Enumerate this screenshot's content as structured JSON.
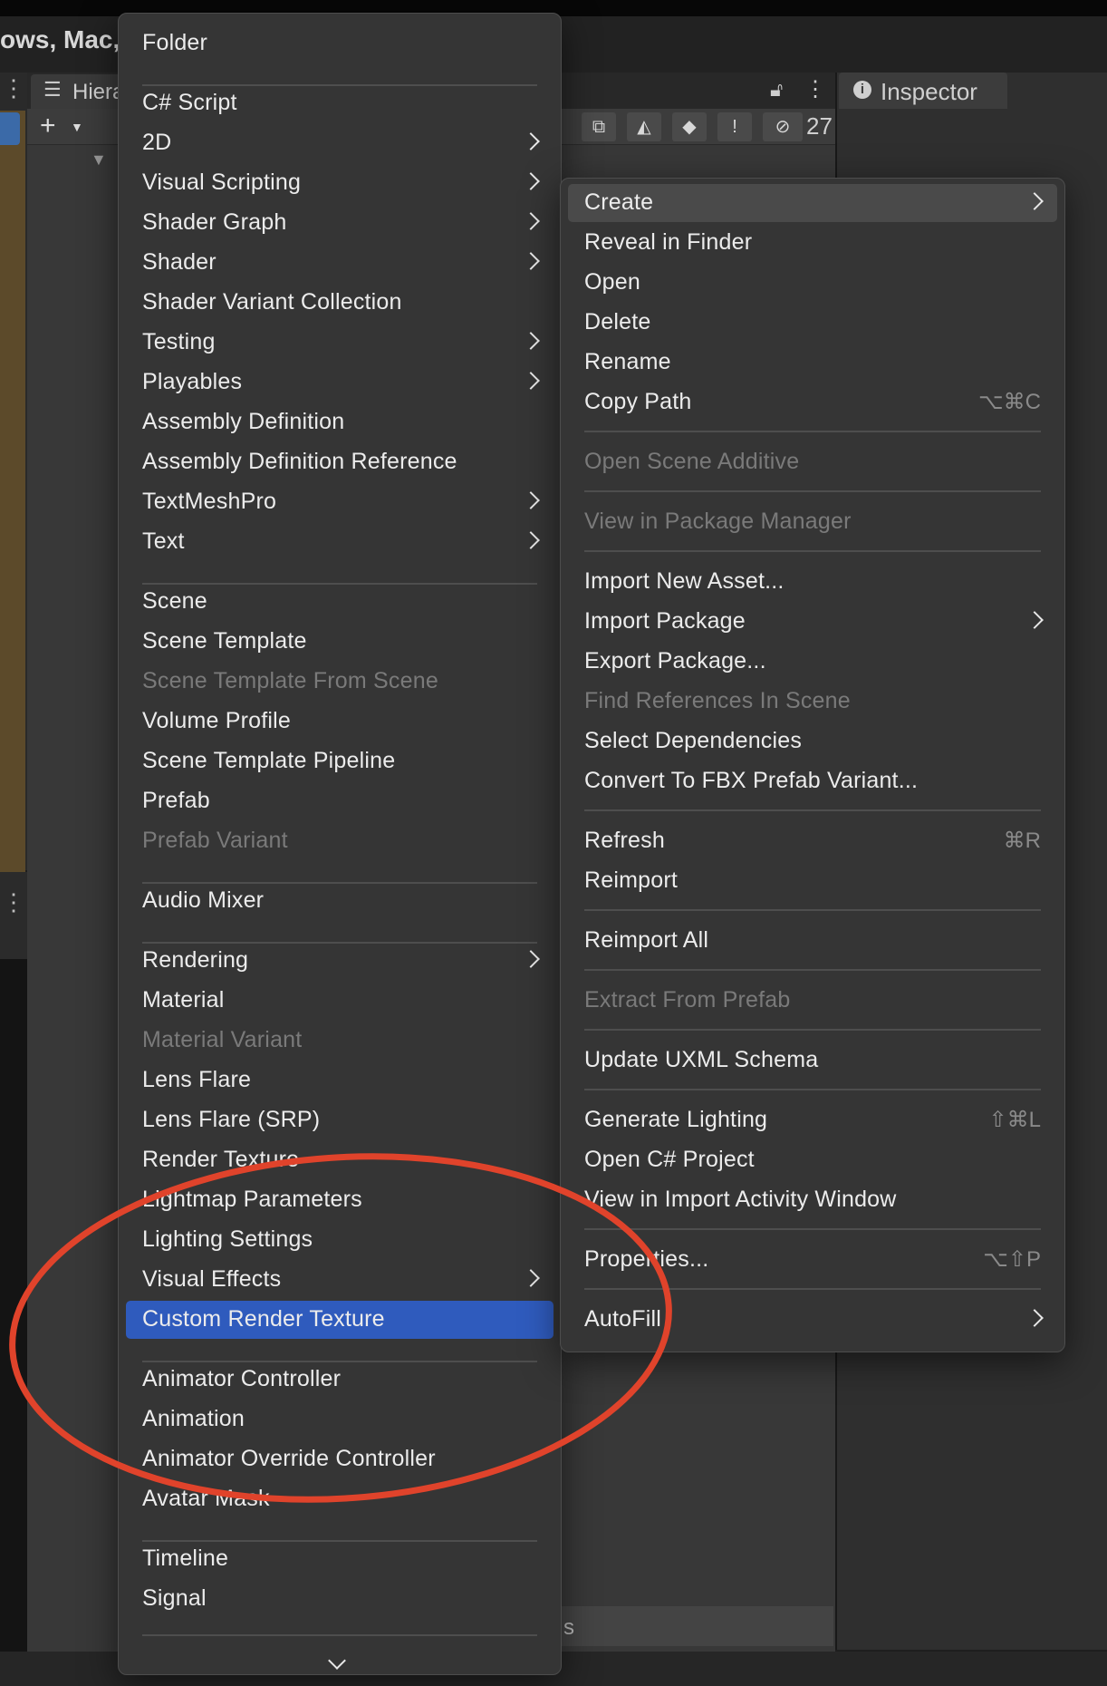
{
  "window": {
    "title_fragment": "ows, Mac,"
  },
  "hierarchy": {
    "tab_label": "Hiera",
    "visibility_count": "27"
  },
  "inspector": {
    "tab_label": "Inspector"
  },
  "project": {
    "bottom_fragment": "s"
  },
  "left_menu": {
    "items": [
      {
        "label": "Folder",
        "submenu": false,
        "disabled": false
      },
      {
        "label": "C# Script",
        "submenu": false,
        "disabled": false
      },
      {
        "label": "2D",
        "submenu": true,
        "disabled": false
      },
      {
        "label": "Visual Scripting",
        "submenu": true,
        "disabled": false
      },
      {
        "label": "Shader Graph",
        "submenu": true,
        "disabled": false
      },
      {
        "label": "Shader",
        "submenu": true,
        "disabled": false
      },
      {
        "label": "Shader Variant Collection",
        "submenu": false,
        "disabled": false
      },
      {
        "label": "Testing",
        "submenu": true,
        "disabled": false
      },
      {
        "label": "Playables",
        "submenu": true,
        "disabled": false
      },
      {
        "label": "Assembly Definition",
        "submenu": false,
        "disabled": false
      },
      {
        "label": "Assembly Definition Reference",
        "submenu": false,
        "disabled": false
      },
      {
        "label": "TextMeshPro",
        "submenu": true,
        "disabled": false
      },
      {
        "label": "Text",
        "submenu": true,
        "disabled": false
      },
      {
        "label": "Scene",
        "submenu": false,
        "disabled": false
      },
      {
        "label": "Scene Template",
        "submenu": false,
        "disabled": false
      },
      {
        "label": "Scene Template From Scene",
        "submenu": false,
        "disabled": true
      },
      {
        "label": "Volume Profile",
        "submenu": false,
        "disabled": false
      },
      {
        "label": "Scene Template Pipeline",
        "submenu": false,
        "disabled": false
      },
      {
        "label": "Prefab",
        "submenu": false,
        "disabled": false
      },
      {
        "label": "Prefab Variant",
        "submenu": false,
        "disabled": true
      },
      {
        "label": "Audio Mixer",
        "submenu": false,
        "disabled": false
      },
      {
        "label": "Rendering",
        "submenu": true,
        "disabled": false
      },
      {
        "label": "Material",
        "submenu": false,
        "disabled": false
      },
      {
        "label": "Material Variant",
        "submenu": false,
        "disabled": true
      },
      {
        "label": "Lens Flare",
        "submenu": false,
        "disabled": false
      },
      {
        "label": "Lens Flare (SRP)",
        "submenu": false,
        "disabled": false
      },
      {
        "label": "Render Texture",
        "submenu": false,
        "disabled": false
      },
      {
        "label": "Lightmap Parameters",
        "submenu": false,
        "disabled": false
      },
      {
        "label": "Lighting Settings",
        "submenu": false,
        "disabled": false
      },
      {
        "label": "Visual Effects",
        "submenu": true,
        "disabled": false
      },
      {
        "label": "Custom Render Texture",
        "submenu": false,
        "disabled": false,
        "selected": true
      },
      {
        "label": "Animator Controller",
        "submenu": false,
        "disabled": false
      },
      {
        "label": "Animation",
        "submenu": false,
        "disabled": false
      },
      {
        "label": "Animator Override Controller",
        "submenu": false,
        "disabled": false
      },
      {
        "label": "Avatar Mask",
        "submenu": false,
        "disabled": false
      },
      {
        "label": "Timeline",
        "submenu": false,
        "disabled": false
      },
      {
        "label": "Signal",
        "submenu": false,
        "disabled": false
      }
    ]
  },
  "right_menu": {
    "items": [
      {
        "label": "Create",
        "submenu": true,
        "disabled": false,
        "highlighted": true
      },
      {
        "label": "Reveal in Finder",
        "disabled": false
      },
      {
        "label": "Open",
        "disabled": false
      },
      {
        "label": "Delete",
        "disabled": false
      },
      {
        "label": "Rename",
        "disabled": false
      },
      {
        "label": "Copy Path",
        "disabled": false,
        "shortcut": "⌥⌘C"
      },
      {
        "label": "Open Scene Additive",
        "disabled": true
      },
      {
        "label": "View in Package Manager",
        "disabled": true
      },
      {
        "label": "Import New Asset...",
        "disabled": false
      },
      {
        "label": "Import Package",
        "submenu": true,
        "disabled": false
      },
      {
        "label": "Export Package...",
        "disabled": false
      },
      {
        "label": "Find References In Scene",
        "disabled": true
      },
      {
        "label": "Select Dependencies",
        "disabled": false
      },
      {
        "label": "Convert To FBX Prefab Variant...",
        "disabled": false
      },
      {
        "label": "Refresh",
        "disabled": false,
        "shortcut": "⌘R"
      },
      {
        "label": "Reimport",
        "disabled": false
      },
      {
        "label": "Reimport All",
        "disabled": false
      },
      {
        "label": "Extract From Prefab",
        "disabled": true
      },
      {
        "label": "Update UXML Schema",
        "disabled": false
      },
      {
        "label": "Generate Lighting",
        "disabled": false,
        "shortcut": "⇧⌘L"
      },
      {
        "label": "Open C# Project",
        "disabled": false
      },
      {
        "label": "View in Import Activity Window",
        "disabled": false
      },
      {
        "label": "Properties...",
        "disabled": false,
        "shortcut": "⌥⇧P"
      },
      {
        "label": "AutoFill",
        "submenu": true,
        "disabled": false
      }
    ]
  },
  "colors": {
    "menu_bg": "#353535",
    "selection": "#2f5bbd",
    "annotation": "#e0432b"
  }
}
